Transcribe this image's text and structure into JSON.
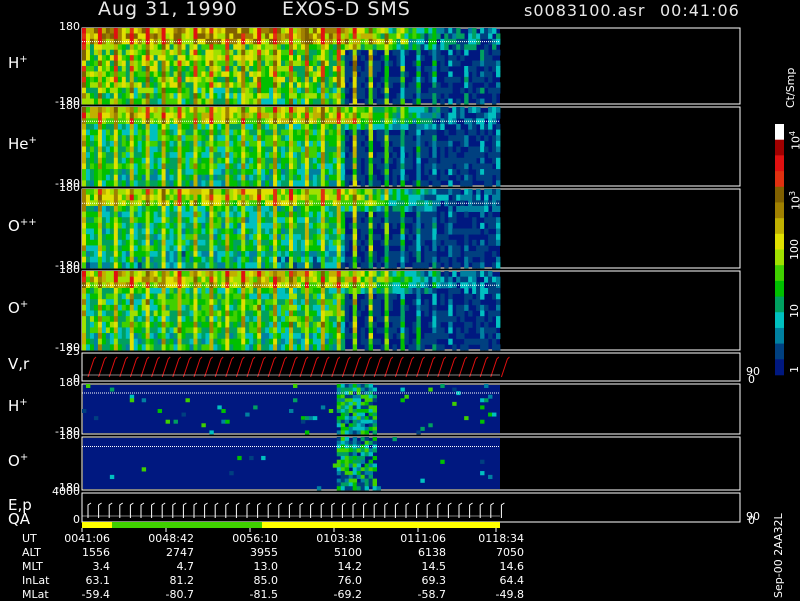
{
  "header": {
    "date": "Aug 31, 1990",
    "instrument": "EXOS-D SMS",
    "file": "s0083100.asr",
    "time": "00:41:06"
  },
  "panels": [
    {
      "name": "h-plus",
      "label": "H",
      "sup": "+",
      "ymax": "180",
      "ymin": "-180",
      "kind": "spectrogram",
      "intensity": 1.0
    },
    {
      "name": "he-plus",
      "label": "He",
      "sup": "+",
      "ymax": "180",
      "ymin": "-180",
      "kind": "spectrogram",
      "intensity": 0.75
    },
    {
      "name": "o-plus-plus",
      "label": "O",
      "sup": "++",
      "ymax": "180",
      "ymin": "-180",
      "kind": "spectrogram",
      "intensity": 0.7
    },
    {
      "name": "o-plus",
      "label": "O",
      "sup": "+",
      "ymax": "180",
      "ymin": "-180",
      "kind": "spectrogram",
      "intensity": 0.8
    },
    {
      "name": "v-r",
      "label": "V,r",
      "sup": "",
      "ymax": "25",
      "ymin": "0",
      "kind": "line",
      "right_top": "90",
      "right_bottom": "0"
    },
    {
      "name": "h-plus-2",
      "label": "H",
      "sup": "+",
      "ymax": "180",
      "ymin": "-180",
      "kind": "sparse",
      "intensity": 0.35
    },
    {
      "name": "o-plus-2",
      "label": "O",
      "sup": "+",
      "ymax": "180",
      "ymin": "-180",
      "kind": "sparse",
      "intensity": 0.1
    },
    {
      "name": "e-p",
      "label": "E,p",
      "sup": "",
      "ymax": "4000",
      "ymin": "0",
      "kind": "step",
      "right_top": "90",
      "right_bottom": "0"
    }
  ],
  "qa_label": "QA",
  "colorbar": {
    "unit": "Ct/Smp",
    "labels": [
      {
        "base": "10",
        "exp": "4"
      },
      {
        "base": "10",
        "exp": "3"
      },
      {
        "base": "100",
        "exp": ""
      },
      {
        "base": "10",
        "exp": ""
      },
      {
        "base": "1",
        "exp": ""
      }
    ],
    "colors": [
      "#ffffff",
      "#a00000",
      "#e01010",
      "#e03010",
      "#806000",
      "#a08000",
      "#c0b000",
      "#e0e000",
      "#a0e000",
      "#40d000",
      "#00c000",
      "#00a060",
      "#00c0c0",
      "#0080a0",
      "#004080",
      "#001880"
    ]
  },
  "ephemeris": {
    "rows": [
      {
        "label": "UT",
        "values": [
          "0041:06",
          "0048:42",
          "0056:10",
          "0103:38",
          "0111:06",
          "0118:34"
        ]
      },
      {
        "label": "ALT",
        "values": [
          "1556",
          "2747",
          "3955",
          "5100",
          "6138",
          "7050"
        ]
      },
      {
        "label": "MLT",
        "values": [
          "3.4",
          "4.7",
          "13.0",
          "14.2",
          "14.5",
          "14.6"
        ]
      },
      {
        "label": "InLat",
        "values": [
          "63.1",
          "81.2",
          "85.0",
          "76.0",
          "69.3",
          "64.4"
        ]
      },
      {
        "label": "MLat",
        "values": [
          "-59.4",
          "-80.7",
          "-81.5",
          "-69.2",
          "-58.7",
          "-49.8"
        ]
      }
    ]
  },
  "footer_code": "Sep-00 2AA32L",
  "chart_data": {
    "type": "heatmap",
    "title": "Aug 31, 1990   EXOS-D SMS",
    "x": [
      "0041:06",
      "0048:42",
      "0056:10",
      "0103:38",
      "0111:06",
      "0118:34"
    ],
    "panels": [
      "H+",
      "He+",
      "O++",
      "O+",
      "V,r",
      "H+",
      "O+",
      "E,p"
    ],
    "ylim": [
      -180,
      180
    ],
    "colorbar": {
      "unit": "Ct/Smp",
      "scale": "log",
      "range": [
        1,
        10000
      ]
    },
    "grid": false,
    "legend": "right"
  }
}
